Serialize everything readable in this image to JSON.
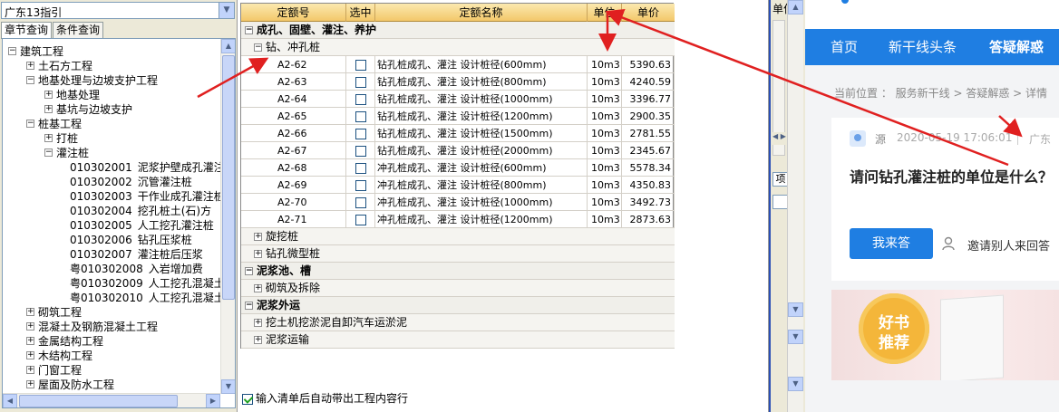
{
  "left_panel": {
    "region_select": "广东13指引",
    "tabs": [
      "章节查询",
      "条件查询"
    ],
    "tree": [
      {
        "level": 0,
        "toggle": "−",
        "label": "建筑工程"
      },
      {
        "level": 1,
        "toggle": "+",
        "label": "土石方工程"
      },
      {
        "level": 1,
        "toggle": "−",
        "label": "地基处理与边坡支护工程"
      },
      {
        "level": 2,
        "toggle": "+",
        "label": "地基处理"
      },
      {
        "level": 2,
        "toggle": "+",
        "label": "基坑与边坡支护"
      },
      {
        "level": 1,
        "toggle": "−",
        "label": "桩基工程"
      },
      {
        "level": 2,
        "toggle": "+",
        "label": "打桩"
      },
      {
        "level": 2,
        "toggle": "−",
        "label": "灌注桩"
      },
      {
        "level": 3,
        "code": "010302001",
        "label": "泥浆护壁成孔灌注"
      },
      {
        "level": 3,
        "code": "010302002",
        "label": "沉管灌注桩"
      },
      {
        "level": 3,
        "code": "010302003",
        "label": "干作业成孔灌注桩"
      },
      {
        "level": 3,
        "code": "010302004",
        "label": "挖孔桩土(石)方"
      },
      {
        "level": 3,
        "code": "010302005",
        "label": "人工挖孔灌注桩"
      },
      {
        "level": 3,
        "code": "010302006",
        "label": "钻孔压浆桩"
      },
      {
        "level": 3,
        "code": "010302007",
        "label": "灌注桩后压浆"
      },
      {
        "level": 3,
        "code": "粤010302008",
        "label": "入岩增加费"
      },
      {
        "level": 3,
        "code": "粤010302009",
        "label": "人工挖孔混凝土"
      },
      {
        "level": 3,
        "code": "粤010302010",
        "label": "人工挖孔混凝土"
      },
      {
        "level": 1,
        "toggle": "+",
        "label": "砌筑工程"
      },
      {
        "level": 1,
        "toggle": "+",
        "label": "混凝土及钢筋混凝土工程"
      },
      {
        "level": 1,
        "toggle": "+",
        "label": "金属结构工程"
      },
      {
        "level": 1,
        "toggle": "+",
        "label": "木结构工程"
      },
      {
        "level": 1,
        "toggle": "+",
        "label": "门窗工程"
      },
      {
        "level": 1,
        "toggle": "+",
        "label": "屋面及防水工程"
      }
    ]
  },
  "grid": {
    "headers": [
      "定额号",
      "选中",
      "定额名称",
      "单位",
      "单价"
    ],
    "rows": [
      {
        "type": "group",
        "toggle": "−",
        "label": "成孔、固壁、灌注、养护"
      },
      {
        "type": "sub",
        "toggle": "−",
        "label": "钻、冲孔桩"
      },
      {
        "type": "item",
        "code": "A2-62",
        "name": "钻孔桩成孔、灌注 设计桩径(600mm)",
        "unit": "10m3",
        "price": "5390.63"
      },
      {
        "type": "item",
        "code": "A2-63",
        "name": "钻孔桩成孔、灌注 设计桩径(800mm)",
        "unit": "10m3",
        "price": "4240.59"
      },
      {
        "type": "item",
        "code": "A2-64",
        "name": "钻孔桩成孔、灌注 设计桩径(1000mm)",
        "unit": "10m3",
        "price": "3396.77"
      },
      {
        "type": "item",
        "code": "A2-65",
        "name": "钻孔桩成孔、灌注 设计桩径(1200mm)",
        "unit": "10m3",
        "price": "2900.35"
      },
      {
        "type": "item",
        "code": "A2-66",
        "name": "钻孔桩成孔、灌注 设计桩径(1500mm)",
        "unit": "10m3",
        "price": "2781.55"
      },
      {
        "type": "item",
        "code": "A2-67",
        "name": "钻孔桩成孔、灌注 设计桩径(2000mm)",
        "unit": "10m3",
        "price": "2345.67"
      },
      {
        "type": "item",
        "code": "A2-68",
        "name": "冲孔桩成孔、灌注 设计桩径(600mm)",
        "unit": "10m3",
        "price": "5578.34"
      },
      {
        "type": "item",
        "code": "A2-69",
        "name": "冲孔桩成孔、灌注 设计桩径(800mm)",
        "unit": "10m3",
        "price": "4350.83"
      },
      {
        "type": "item",
        "code": "A2-70",
        "name": "冲孔桩成孔、灌注 设计桩径(1000mm)",
        "unit": "10m3",
        "price": "3492.73"
      },
      {
        "type": "item",
        "code": "A2-71",
        "name": "冲孔桩成孔、灌注 设计桩径(1200mm)",
        "unit": "10m3",
        "price": "2873.63"
      },
      {
        "type": "sub",
        "toggle": "+",
        "label": "旋挖桩"
      },
      {
        "type": "sub",
        "toggle": "+",
        "label": "钻孔微型桩"
      },
      {
        "type": "group",
        "toggle": "−",
        "label": "泥浆池、槽"
      },
      {
        "type": "sub",
        "toggle": "+",
        "label": "砌筑及拆除"
      },
      {
        "type": "group",
        "toggle": "−",
        "label": "泥浆外运"
      },
      {
        "type": "sub",
        "toggle": "+",
        "label": "挖土机挖淤泥自卸汽车运淤泥"
      },
      {
        "type": "sub",
        "toggle": "+",
        "label": "泥浆运输"
      }
    ],
    "auto_option": "输入清单后自动带出工程内容行"
  },
  "strip": {
    "label_top": "单位",
    "button_label": "项"
  },
  "web": {
    "nav": [
      "首页",
      "新干线头条",
      "答疑解惑"
    ],
    "breadcrumb": "当前位置 ： 服务新干线 > 答疑解惑 > 详情",
    "card": {
      "source": "源",
      "date": "2020-05-19 17:06:01",
      "province": "广东",
      "question": "请问钻孔灌注桩的单位是什么？",
      "answer_button": "我来答",
      "invite": "邀请别人来回答"
    },
    "banner": {
      "badge_line1": "好书",
      "badge_line2": "推荐"
    }
  },
  "colors": {
    "header_gold": "#f3c86a",
    "nav_blue": "#1f7ee2",
    "arrow_red": "#e02020"
  }
}
